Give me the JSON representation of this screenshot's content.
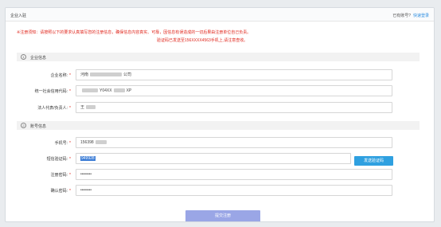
{
  "header": {
    "title": "企业入驻",
    "have_account": "已有账号?",
    "quick_login": "快速登录"
  },
  "notice": {
    "line1": "※注册须知：请按照以下的要求认真填写您的注册信息，确保信息内容真实、可靠，因信息有误造成的一切后果由注册单位自己负责。",
    "line2": "验证码已发送至156XXXX4563手机上,请注意查收。"
  },
  "sections": {
    "company": {
      "num": "1",
      "title": "企业信息"
    },
    "account": {
      "num": "2",
      "title": "账号信息"
    }
  },
  "fields": {
    "company_name": {
      "label": "企业名称:",
      "value_prefix": "河南",
      "value_suffix": "公司"
    },
    "credit_code": {
      "label": "统一社会信用代码:",
      "value_mid": "Y04XX",
      "value_suffix": "XP"
    },
    "legal_rep": {
      "label": "法人代表/负责人:",
      "value_prefix": "王"
    },
    "phone": {
      "label": "手机号:",
      "value_prefix": "156398"
    },
    "sms_code": {
      "label": "短信验证码:",
      "value": "949928"
    },
    "password": {
      "label": "注册密码:",
      "value": "••••••••"
    },
    "confirm_password": {
      "label": "确认密码:",
      "value": "••••••••"
    }
  },
  "required_mark": "*",
  "buttons": {
    "send_code": "发送验证码",
    "submit": "提交注册"
  }
}
